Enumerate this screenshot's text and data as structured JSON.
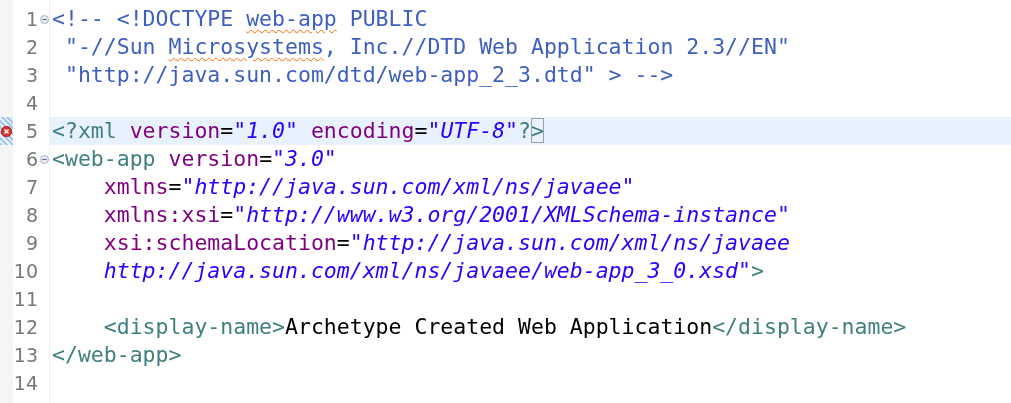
{
  "editor": {
    "lines": [
      {
        "number": "1",
        "foldable": true,
        "error": false,
        "current": false,
        "tokens": [
          {
            "t": "<!-- <!DOCTYPE ",
            "kind": "comment"
          },
          {
            "t": "web-app",
            "kind": "comment",
            "misspelled": true
          },
          {
            "t": " PUBLIC",
            "kind": "comment"
          }
        ]
      },
      {
        "number": "2",
        "foldable": false,
        "error": false,
        "current": false,
        "tokens": [
          {
            "t": " \"-//Sun ",
            "kind": "comment"
          },
          {
            "t": "Microsystems",
            "kind": "comment",
            "misspelled": true
          },
          {
            "t": ", Inc.//DTD Web Application 2.3//EN\"",
            "kind": "comment"
          }
        ]
      },
      {
        "number": "3",
        "foldable": false,
        "error": false,
        "current": false,
        "tokens": [
          {
            "t": " \"http://java.sun.com/dtd/web-app_2_3.dtd\" > -->",
            "kind": "comment"
          }
        ]
      },
      {
        "number": "4",
        "foldable": false,
        "error": false,
        "current": false
      },
      {
        "number": "5",
        "foldable": false,
        "error": true,
        "current": true,
        "tokens": [
          {
            "t": "<?xml",
            "kind": "tag"
          },
          {
            "t": " version",
            "kind": "attr"
          },
          {
            "t": "=",
            "kind": "text"
          },
          {
            "t": "\"1.0\"",
            "kind": "string"
          },
          {
            "t": " encoding",
            "kind": "attr"
          },
          {
            "t": "=",
            "kind": "text"
          },
          {
            "t": "\"UTF-8\"",
            "kind": "string"
          },
          {
            "t": "?",
            "kind": "tag"
          },
          {
            "t": ">",
            "kind": "tag",
            "matched": true
          }
        ]
      },
      {
        "number": "6",
        "foldable": true,
        "error": false,
        "current": false,
        "tokens": [
          {
            "t": "<web-app",
            "kind": "tag"
          },
          {
            "t": " version",
            "kind": "attr"
          },
          {
            "t": "=",
            "kind": "text"
          },
          {
            "t": "\"3.0\"",
            "kind": "string"
          }
        ]
      },
      {
        "number": "7",
        "foldable": false,
        "error": false,
        "current": false,
        "tokens": [
          {
            "t": "    xmlns",
            "kind": "attr"
          },
          {
            "t": "=",
            "kind": "text"
          },
          {
            "t": "\"http://java.sun.com/xml/ns/javaee\"",
            "kind": "string"
          }
        ]
      },
      {
        "number": "8",
        "foldable": false,
        "error": false,
        "current": false,
        "tokens": [
          {
            "t": "    xmlns:xsi",
            "kind": "attr"
          },
          {
            "t": "=",
            "kind": "text"
          },
          {
            "t": "\"http://www.w3.org/2001/XMLSchema-instance\"",
            "kind": "string"
          }
        ]
      },
      {
        "number": "9",
        "foldable": false,
        "error": false,
        "current": false,
        "tokens": [
          {
            "t": "    xsi:schemaLocation",
            "kind": "attr"
          },
          {
            "t": "=",
            "kind": "text"
          },
          {
            "t": "\"http://java.sun.com/xml/ns/javaee",
            "kind": "string"
          }
        ]
      },
      {
        "number": "10",
        "foldable": false,
        "error": false,
        "current": false,
        "tokens": [
          {
            "t": "    http://java.sun.com/xml/ns/javaee/web-app_3_0.xsd\"",
            "kind": "string"
          },
          {
            "t": ">",
            "kind": "tag"
          }
        ]
      },
      {
        "number": "11",
        "foldable": false,
        "error": false,
        "current": false
      },
      {
        "number": "12",
        "foldable": false,
        "error": false,
        "current": false,
        "tokens": [
          {
            "t": "    <display-name>",
            "kind": "tag"
          },
          {
            "t": "Archetype Created Web Application",
            "kind": "text"
          },
          {
            "t": "</display-name>",
            "kind": "tag"
          }
        ]
      },
      {
        "number": "13",
        "foldable": false,
        "error": false,
        "current": false,
        "tokens": [
          {
            "t": "</web-app>",
            "kind": "tag"
          }
        ]
      },
      {
        "number": "14",
        "foldable": false,
        "error": false,
        "current": false
      }
    ]
  }
}
